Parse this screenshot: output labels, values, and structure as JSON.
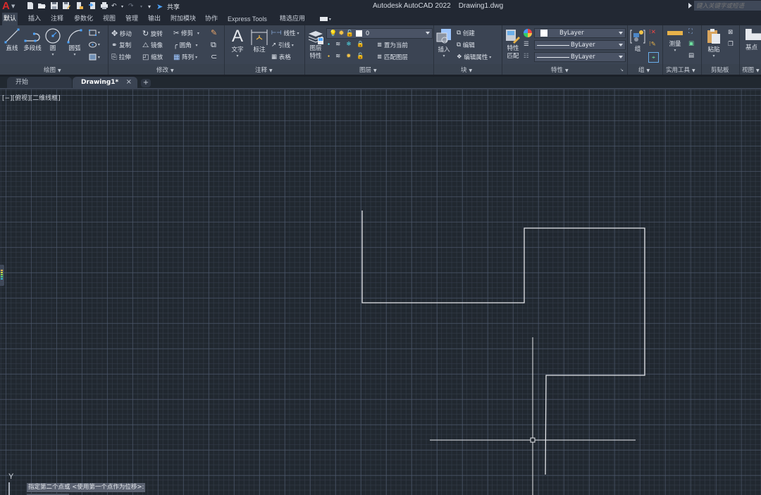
{
  "app": {
    "title": "Autodesk AutoCAD 2022",
    "document": "Drawing1.dwg",
    "logo": "A",
    "share_label": "共享",
    "search_placeholder": "键入关键字或短语"
  },
  "quick_access": [
    "new-icon",
    "open-icon",
    "save-icon",
    "save-as-icon",
    "plot-preview-icon",
    "publish-icon",
    "print-icon",
    "undo-icon",
    "redo-icon",
    "customize-icon",
    "share-icon"
  ],
  "ribbon_tabs": [
    {
      "label": "默认",
      "active": true
    },
    {
      "label": "插入"
    },
    {
      "label": "注释"
    },
    {
      "label": "参数化"
    },
    {
      "label": "视图"
    },
    {
      "label": "管理"
    },
    {
      "label": "输出"
    },
    {
      "label": "附加模块"
    },
    {
      "label": "协作"
    },
    {
      "label": "Express Tools"
    },
    {
      "label": "精选应用"
    }
  ],
  "panels": {
    "draw": {
      "label": "绘图",
      "line": "直线",
      "polyline": "多段线",
      "circle": "圆",
      "arc": "圆弧"
    },
    "modify": {
      "label": "修改",
      "move": "移动",
      "rotate": "旋转",
      "trim": "修剪",
      "copy": "复制",
      "mirror": "镜像",
      "fillet": "圆角",
      "stretch": "拉伸",
      "scale": "缩放",
      "array": "阵列"
    },
    "annotation": {
      "label": "注释",
      "text": "文字",
      "dimension": "标注",
      "linear": "线性",
      "leader": "引线",
      "table": "表格"
    },
    "layers": {
      "label": "图层",
      "layer_properties_line1": "图层",
      "layer_properties_line2": "特性",
      "current_layer": "0",
      "make_current": "置为当前",
      "match_layer": "匹配图层"
    },
    "block": {
      "label": "块",
      "insert": "插入",
      "create": "创建",
      "edit": "编辑",
      "edit_attributes": "编辑属性"
    },
    "properties": {
      "label": "特性",
      "match_line1": "特性",
      "match_line2": "匹配",
      "color": "ByLayer",
      "linetype": "ByLayer",
      "lineweight": "ByLayer"
    },
    "groups": {
      "label": "组",
      "group": "组"
    },
    "utilities": {
      "label": "实用工具",
      "measure": "测量"
    },
    "clipboard": {
      "label": "剪贴板",
      "paste": "粘贴"
    },
    "view": {
      "label": "视图",
      "base": "基点"
    }
  },
  "doc_tabs": [
    {
      "label": "开始",
      "active": false
    },
    {
      "label": "Drawing1*",
      "active": true,
      "close": "×"
    }
  ],
  "add_tab": "+",
  "viewport": {
    "label": "[−][俯视][二维线框]",
    "ucs_y": "Y",
    "command_prompt": "指定第二个点或 <使用第一个点作为位移>:"
  },
  "colors": {
    "background": "#212830",
    "ribbon": "#3b4453",
    "geometry": "#e6e8ec",
    "accent": "#4da3ff"
  }
}
